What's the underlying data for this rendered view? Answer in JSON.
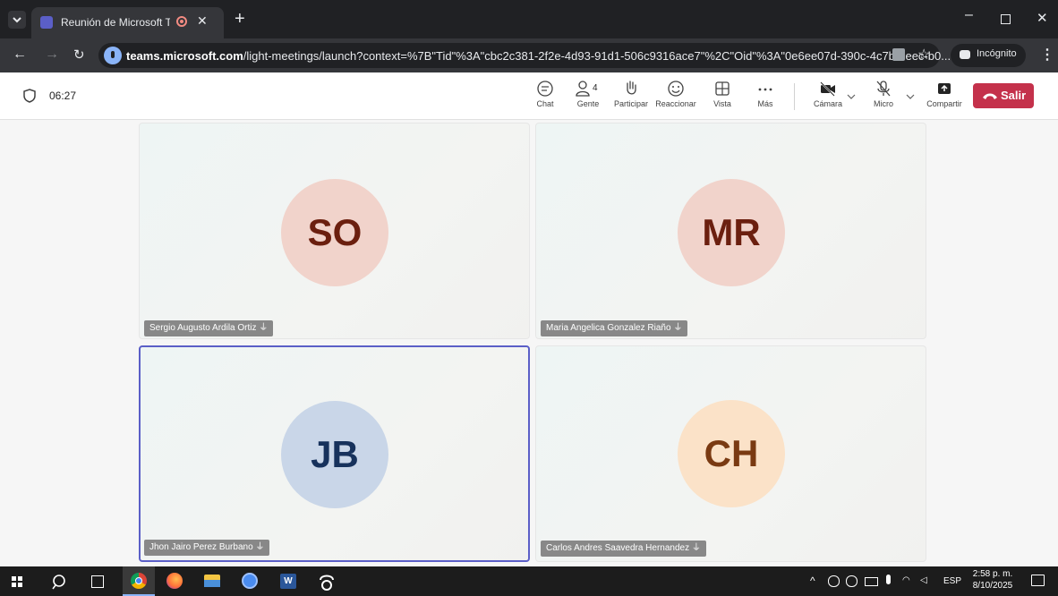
{
  "browser": {
    "tab_title": "Reunión de Microsoft Teams",
    "new_tab": "+",
    "url_host": "teams.microsoft.com",
    "url_path": "/light-meetings/launch?context=%7B\"Tid\"%3A\"cbc2c381-2f2e-4d93-91d1-506c9316ace7\"%2C\"Oid\"%3A\"0e6ee07d-390c-4c7b-8eec-b0...",
    "incognito_label": "Incógnito"
  },
  "meeting": {
    "timer": "06:27",
    "toolbar": {
      "chat": "Chat",
      "people": "Gente",
      "people_count": "4",
      "raise": "Participar",
      "react": "Reaccionar",
      "view": "Vista",
      "more": "Más",
      "camera": "Cámara",
      "mic": "Micro",
      "share": "Compartir",
      "leave": "Salir"
    },
    "participants": [
      {
        "initials": "SO",
        "name": "Sergio Augusto Ardila Ortiz",
        "avatar_bg": "#f1d3cb",
        "avatar_fg": "#6b1f0f"
      },
      {
        "initials": "MR",
        "name": "Maria Angelica Gonzalez Riaño",
        "avatar_bg": "#f1d3cb",
        "avatar_fg": "#6b1f0f"
      },
      {
        "initials": "JB",
        "name": "Jhon Jairo Perez Burbano",
        "avatar_bg": "#c9d6e8",
        "avatar_fg": "#17325c"
      },
      {
        "initials": "CH",
        "name": "Carlos Andres Saavedra Hernandez",
        "avatar_bg": "#fbe2c8",
        "avatar_fg": "#7a3a12"
      }
    ]
  },
  "taskbar": {
    "language": "ESP",
    "time": "2:58 p. m.",
    "date": "8/10/2025"
  },
  "colors": {
    "accent": "#5b5fc7",
    "leave": "#c4314b"
  }
}
